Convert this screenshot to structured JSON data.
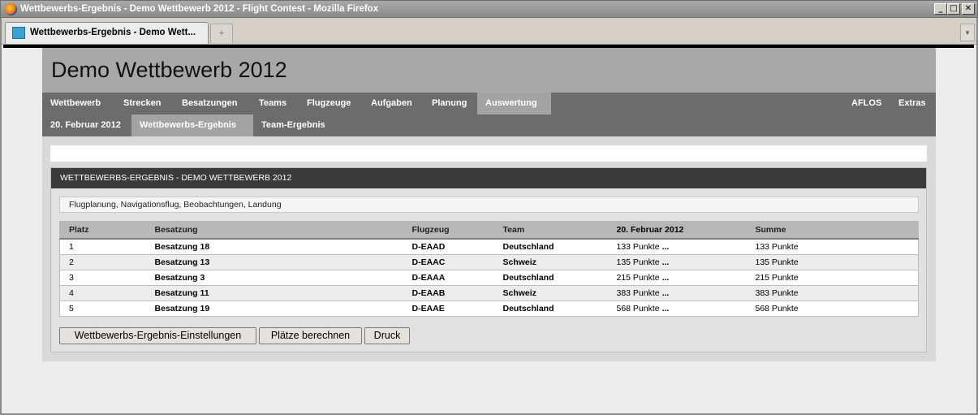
{
  "window": {
    "title": "Wettbewerbs-Ergebnis - Demo Wettbewerb 2012 - Flight Contest - Mozilla Firefox",
    "minimize": "_",
    "maximize": "□",
    "close": "✕"
  },
  "browser": {
    "tab_title": "Wettbewerbs-Ergebnis - Demo Wett...",
    "new_tab": "+",
    "tab_list": "▾"
  },
  "page": {
    "heading": "Demo Wettbewerb 2012",
    "main_nav": [
      "Wettbewerb",
      "Strecken",
      "Besatzungen",
      "Teams",
      "Flugzeuge",
      "Aufgaben",
      "Planung",
      "Auswertung"
    ],
    "main_nav_active": "Auswertung",
    "right_nav": [
      "AFLOS",
      "Extras"
    ],
    "sub_nav": [
      "20. Februar 2012",
      "Wettbewerbs-Ergebnis",
      "Team-Ergebnis"
    ],
    "sub_nav_active": "Wettbewerbs-Ergebnis",
    "box_title": "WETTBEWERBS-ERGEBNIS - DEMO WETTBEWERB 2012",
    "info": "Flugplanung, Navigationsflug, Beobachtungen, Landung",
    "table": {
      "headers": [
        "Platz",
        "Besatzung",
        "Flugzeug",
        "Team",
        "20. Februar 2012",
        "Summe"
      ],
      "rows": [
        [
          "1",
          "Besatzung 18",
          "D-EAAD",
          "Deutschland",
          "133 Punkte",
          "...",
          "133 Punkte"
        ],
        [
          "2",
          "Besatzung 13",
          "D-EAAC",
          "Schweiz",
          "135 Punkte",
          "...",
          "135 Punkte"
        ],
        [
          "3",
          "Besatzung 3",
          "D-EAAA",
          "Deutschland",
          "215 Punkte",
          "...",
          "215 Punkte"
        ],
        [
          "4",
          "Besatzung 11",
          "D-EAAB",
          "Schweiz",
          "383 Punkte",
          "...",
          "383 Punkte"
        ],
        [
          "5",
          "Besatzung 19",
          "D-EAAE",
          "Deutschland",
          "568 Punkte",
          "...",
          "568 Punkte"
        ]
      ]
    },
    "buttons": [
      "Wettbewerbs-Ergebnis-Einstellungen",
      "Plätze berechnen",
      "Druck"
    ]
  },
  "colors": {
    "nav_bg": "#6c6c6c",
    "nav_active": "#a3a3a3",
    "banner": "#a8a8a8",
    "box_header": "#3a3a3a"
  }
}
